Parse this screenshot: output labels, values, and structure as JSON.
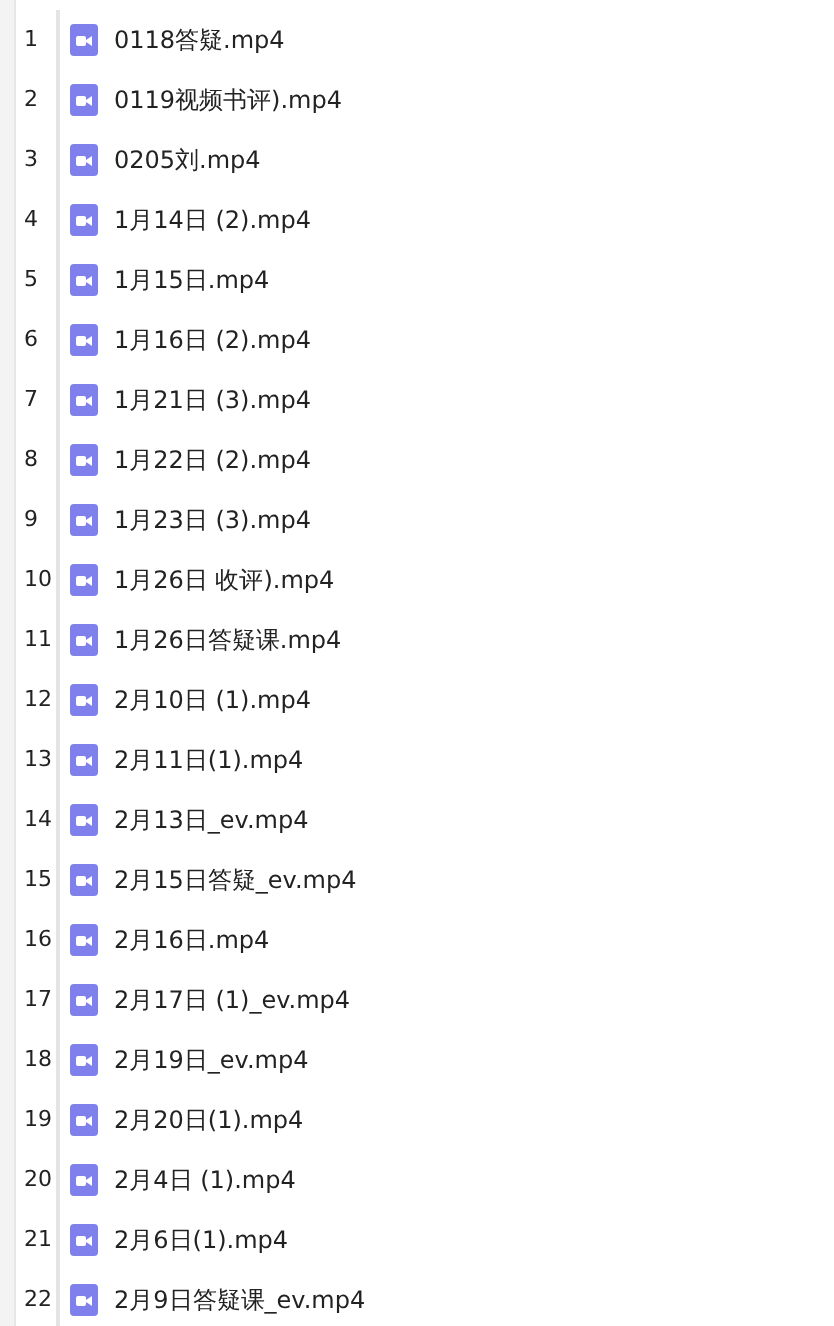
{
  "rows": [
    {
      "number": "1",
      "name": "0118答疑.mp4"
    },
    {
      "number": "2",
      "name": "0119视频书评).mp4"
    },
    {
      "number": "3",
      "name": "0205刘.mp4"
    },
    {
      "number": "4",
      "name": "1月14日 (2).mp4"
    },
    {
      "number": "5",
      "name": "1月15日.mp4"
    },
    {
      "number": "6",
      "name": "1月16日 (2).mp4"
    },
    {
      "number": "7",
      "name": "1月21日 (3).mp4"
    },
    {
      "number": "8",
      "name": "1月22日 (2).mp4"
    },
    {
      "number": "9",
      "name": "1月23日 (3).mp4"
    },
    {
      "number": "10",
      "name": "1月26日 收评).mp4"
    },
    {
      "number": "11",
      "name": "1月26日答疑课.mp4"
    },
    {
      "number": "12",
      "name": "2月10日 (1).mp4"
    },
    {
      "number": "13",
      "name": "2月11日(1).mp4"
    },
    {
      "number": "14",
      "name": "2月13日_ev.mp4"
    },
    {
      "number": "15",
      "name": "2月15日答疑_ev.mp4"
    },
    {
      "number": "16",
      "name": "2月16日.mp4"
    },
    {
      "number": "17",
      "name": "2月17日 (1)_ev.mp4"
    },
    {
      "number": "18",
      "name": "2月19日_ev.mp4"
    },
    {
      "number": "19",
      "name": "2月20日(1).mp4"
    },
    {
      "number": "20",
      "name": "2月4日 (1).mp4"
    },
    {
      "number": "21",
      "name": "2月6日(1).mp4"
    },
    {
      "number": "22",
      "name": "2月9日答疑课_ev.mp4"
    }
  ]
}
